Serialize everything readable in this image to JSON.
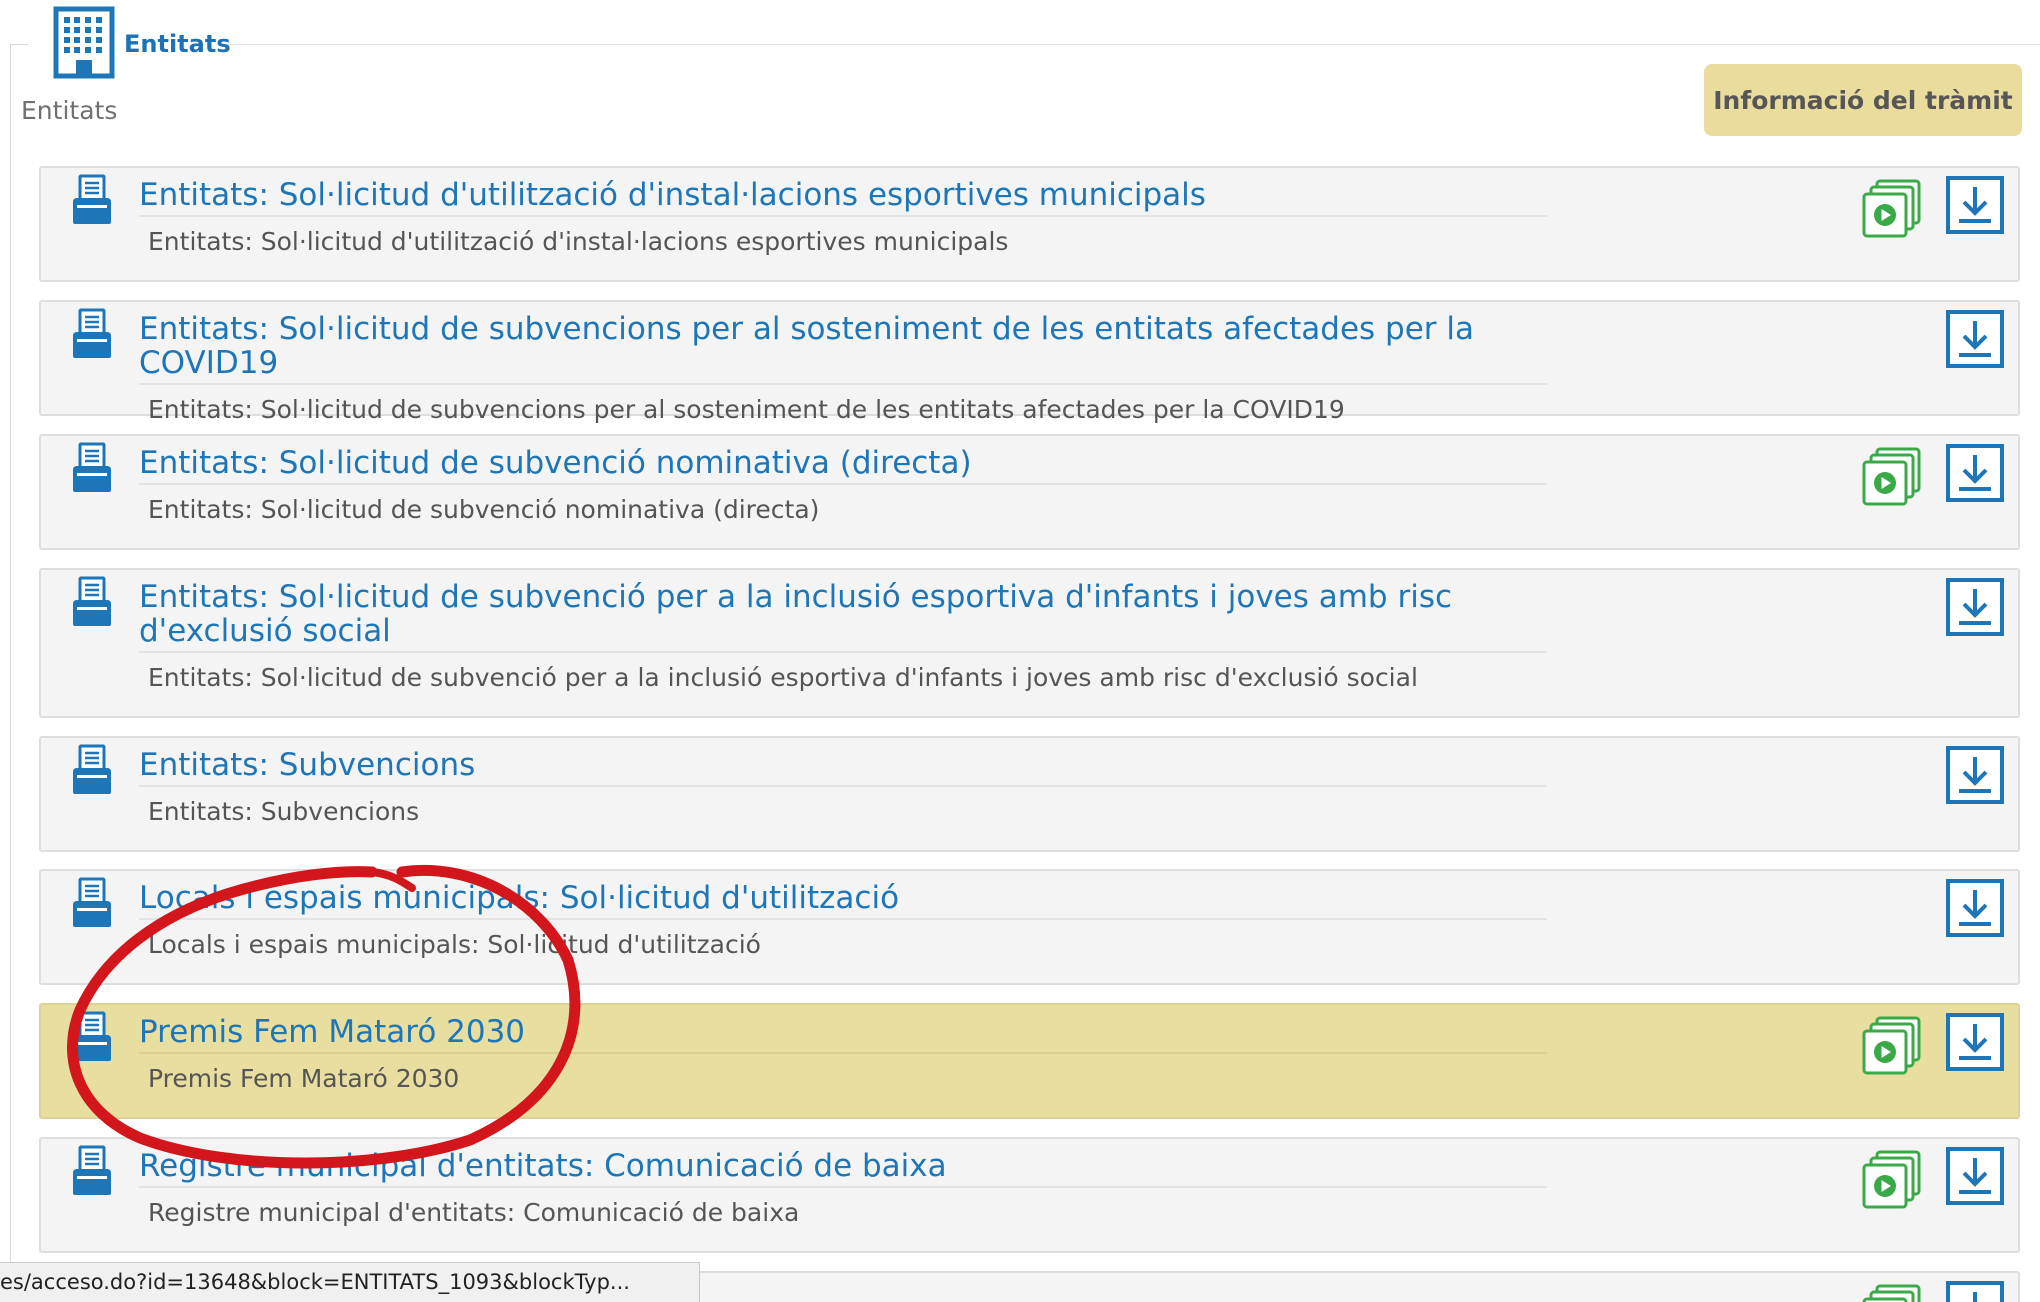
{
  "section": {
    "legend_label": "Entitats",
    "subtitle": "Entitats"
  },
  "info_button": {
    "label": "Informació del tràmit"
  },
  "colors": {
    "link": "#1d76b8",
    "highlight": "#e7dea0",
    "info_button": "#eadc9c",
    "video_icon": "#3aaa49",
    "download_icon": "#1d76b8",
    "annotation": "#d2161b"
  },
  "procedures": [
    {
      "title": "Entitats: Sol·licitud d'utilització d'instal·lacions esportives municipals",
      "description": "Entitats: Sol·licitud d'utilització d'instal·lacions esportives municipals",
      "icons": [
        "form-icon",
        "video-icon",
        "download-icon"
      ],
      "has_video": true,
      "highlighted": false
    },
    {
      "title": "Entitats: Sol·licitud de subvencions per al sosteniment de les entitats afectades per la COVID19",
      "description": "Entitats: Sol·licitud de subvencions per al sosteniment de les entitats afectades per la COVID19",
      "icons": [
        "form-icon",
        "download-icon"
      ],
      "has_video": false,
      "highlighted": false
    },
    {
      "title": "Entitats: Sol·licitud de subvenció nominativa (directa)",
      "description": "Entitats: Sol·licitud de subvenció nominativa (directa)",
      "icons": [
        "form-icon",
        "video-icon",
        "download-icon"
      ],
      "has_video": true,
      "highlighted": false
    },
    {
      "title": "Entitats: Sol·licitud de subvenció per a la inclusió esportiva d'infants i joves amb risc d'exclusió social",
      "description": "Entitats: Sol·licitud de subvenció per a la inclusió esportiva d'infants i joves amb risc d'exclusió social",
      "icons": [
        "form-icon",
        "download-icon"
      ],
      "has_video": false,
      "highlighted": false
    },
    {
      "title": "Entitats: Subvencions",
      "description": "Entitats: Subvencions",
      "icons": [
        "form-icon",
        "download-icon"
      ],
      "has_video": false,
      "highlighted": false
    },
    {
      "title": "Locals i espais municipals: Sol·licitud d'utilització",
      "description": "Locals i espais municipals: Sol·licitud d'utilització",
      "icons": [
        "form-icon",
        "download-icon"
      ],
      "has_video": false,
      "highlighted": false
    },
    {
      "title": "Premis Fem Mataró 2030",
      "description": "Premis Fem Mataró 2030",
      "icons": [
        "form-icon",
        "video-icon",
        "download-icon"
      ],
      "has_video": true,
      "highlighted": true
    },
    {
      "title": "Registre municipal d'entitats: Comunicació de baixa",
      "description": "Registre municipal d'entitats: Comunicació de baixa",
      "icons": [
        "form-icon",
        "video-icon",
        "download-icon"
      ],
      "has_video": true,
      "highlighted": false
    }
  ],
  "partial_row": {
    "icons": [
      "video-icon",
      "download-icon"
    ]
  },
  "status_bar": {
    "url": "es/acceso.do?id=13648&block=ENTITATS_1093&blockTyp..."
  },
  "annotation": {
    "shape": "hand-drawn-circle",
    "target": "Premis Fem Mataró 2030"
  }
}
